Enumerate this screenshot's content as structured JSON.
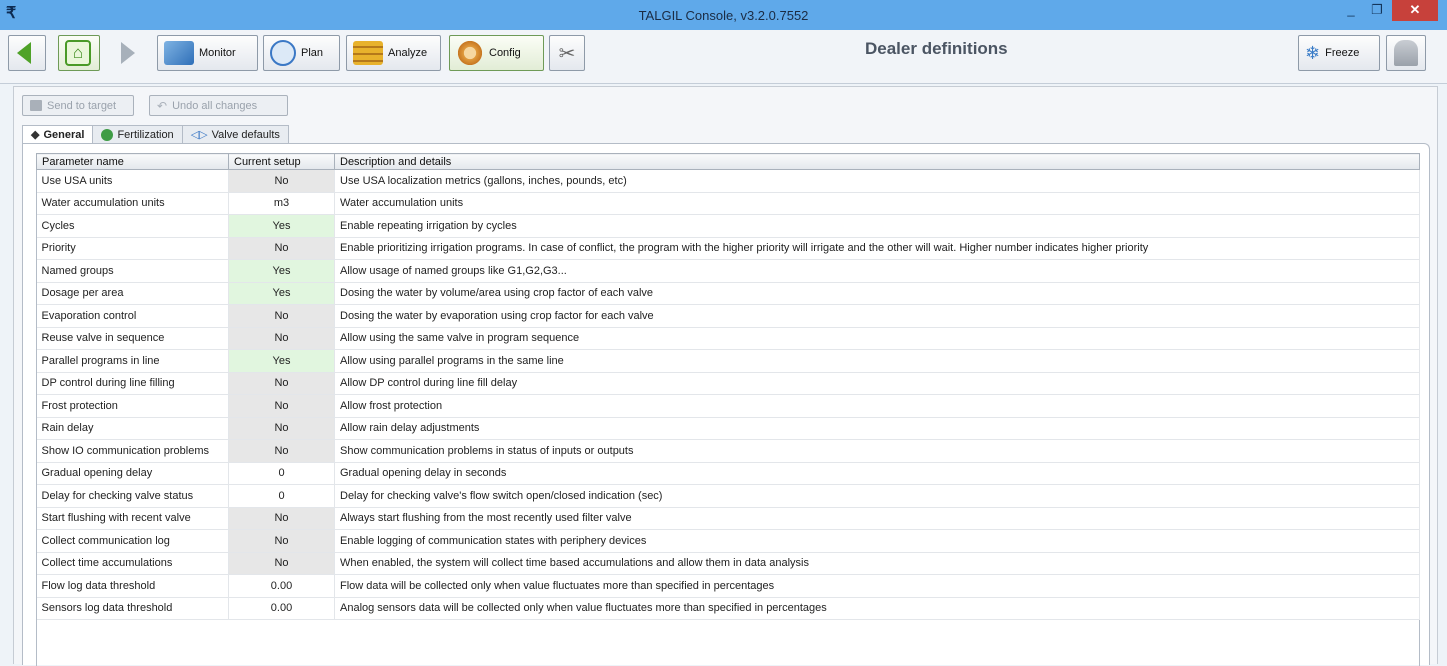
{
  "window": {
    "title": "TALGIL Console, v3.2.0.7552",
    "min_glyph": "_",
    "max_glyph": "❐",
    "close_glyph": "✕"
  },
  "toolbar": {
    "monitor_label": "Monitor",
    "plan_label": "Plan",
    "analyze_label": "Analyze",
    "config_label": "Config",
    "freeze_label": "Freeze"
  },
  "page_title": "Dealer definitions",
  "actions": {
    "send_label": "Send to target",
    "undo_label": "Undo all changes"
  },
  "tabs": [
    {
      "label": "General",
      "icon": "general-icon",
      "active": true
    },
    {
      "label": "Fertilization",
      "icon": "fertilization-icon",
      "active": false
    },
    {
      "label": "Valve defaults",
      "icon": "valve-icon",
      "active": false
    }
  ],
  "table": {
    "headers": [
      "Parameter name",
      "Current setup",
      "Description and details"
    ],
    "rows": [
      {
        "name": "Use USA units",
        "value": "No",
        "tone": "gray",
        "desc": "Use USA localization metrics (gallons, inches, pounds, etc)"
      },
      {
        "name": "Water accumulation units",
        "value": "m3",
        "tone": "white",
        "desc": "Water accumulation units"
      },
      {
        "name": "Cycles",
        "value": "Yes",
        "tone": "green",
        "desc": "Enable repeating irrigation by cycles"
      },
      {
        "name": "Priority",
        "value": "No",
        "tone": "gray",
        "desc": "Enable prioritizing irrigation programs. In case of conflict, the program with the higher priority will irrigate and the other will wait. Higher number indicates higher priority"
      },
      {
        "name": "Named groups",
        "value": "Yes",
        "tone": "green",
        "desc": "Allow usage of named groups like G1,G2,G3..."
      },
      {
        "name": "Dosage per area",
        "value": "Yes",
        "tone": "green",
        "desc": "Dosing the water by volume/area using crop factor of each valve"
      },
      {
        "name": "Evaporation control",
        "value": "No",
        "tone": "gray",
        "desc": "Dosing the water by evaporation using crop factor for each valve"
      },
      {
        "name": "Reuse valve in sequence",
        "value": "No",
        "tone": "gray",
        "desc": "Allow using the same valve in program sequence"
      },
      {
        "name": "Parallel programs in line",
        "value": "Yes",
        "tone": "green",
        "desc": "Allow using parallel programs in the same line"
      },
      {
        "name": "DP control during line filling",
        "value": "No",
        "tone": "gray",
        "desc": "Allow DP control during line fill delay"
      },
      {
        "name": "Frost protection",
        "value": "No",
        "tone": "gray",
        "desc": "Allow frost protection"
      },
      {
        "name": "Rain delay",
        "value": "No",
        "tone": "gray",
        "desc": "Allow rain delay adjustments"
      },
      {
        "name": "Show IO communication problems",
        "value": "No",
        "tone": "gray",
        "desc": "Show communication problems in status of inputs or outputs"
      },
      {
        "name": "Gradual opening delay",
        "value": "0",
        "tone": "white",
        "desc": "Gradual opening delay in seconds"
      },
      {
        "name": "Delay for checking valve status",
        "value": "0",
        "tone": "white",
        "desc": "Delay for checking valve's flow switch open/closed indication (sec)"
      },
      {
        "name": "Start flushing with recent valve",
        "value": "No",
        "tone": "gray",
        "desc": "Always start flushing from the most recently used filter valve"
      },
      {
        "name": "Collect communication log",
        "value": "No",
        "tone": "gray",
        "desc": "Enable logging of communication states with periphery devices"
      },
      {
        "name": "Collect time accumulations",
        "value": "No",
        "tone": "gray",
        "desc": "When enabled, the system will collect time based accumulations and allow them in data analysis"
      },
      {
        "name": "Flow log data threshold",
        "value": "0.00",
        "tone": "white",
        "desc": "Flow data will be collected only when value fluctuates more than specified in percentages"
      },
      {
        "name": "Sensors log data threshold",
        "value": "0.00",
        "tone": "white",
        "desc": "Analog sensors data will be collected only when value fluctuates more than specified in percentages"
      }
    ]
  },
  "colors": {
    "titlebar": "#5fa9ea",
    "close": "#c7413b",
    "yes_bg": "#e1f6df",
    "no_bg": "#e7e7e7"
  }
}
